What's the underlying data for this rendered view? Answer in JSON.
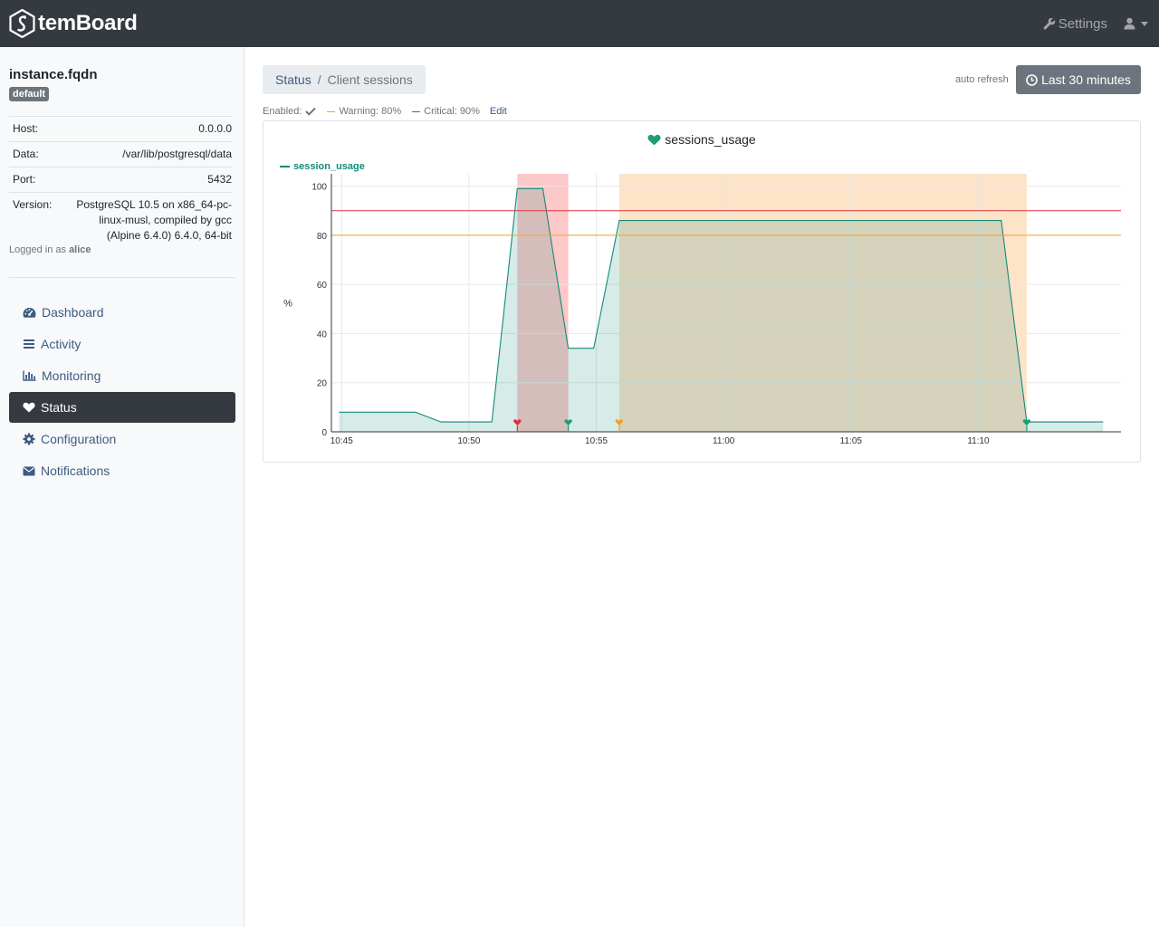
{
  "app": {
    "brand": "temBoard"
  },
  "navbar": {
    "settings_label": "Settings",
    "settings_icon": "wrench-icon",
    "user_icon": "user-icon"
  },
  "sidebar": {
    "instance_name": "instance.fqdn",
    "environment_badge": "default",
    "info": [
      {
        "label": "Host:",
        "value": "0.0.0.0"
      },
      {
        "label": "Data:",
        "value": "/var/lib/postgresql/data"
      },
      {
        "label": "Port:",
        "value": "5432"
      },
      {
        "label": "Version:",
        "value": "PostgreSQL 10.5 on x86_64-pc-linux-musl, compiled by gcc (Alpine 6.4.0) 6.4.0, 64-bit"
      }
    ],
    "logged_in_prefix": "Logged in as",
    "username": "alice",
    "menu": [
      {
        "label": "Dashboard",
        "icon": "tachometer-icon",
        "active": false
      },
      {
        "label": "Activity",
        "icon": "list-icon",
        "active": false
      },
      {
        "label": "Monitoring",
        "icon": "bar-chart-icon",
        "active": false
      },
      {
        "label": "Status",
        "icon": "heart-icon",
        "active": true
      },
      {
        "label": "Configuration",
        "icon": "gear-icon",
        "active": false
      },
      {
        "label": "Notifications",
        "icon": "envelope-icon",
        "active": false
      }
    ]
  },
  "breadcrumb": {
    "parent": "Status",
    "separator": "/",
    "current": "Client sessions"
  },
  "toolbar": {
    "auto_refresh": "auto refresh",
    "range_label": "Last 30 minutes",
    "range_icon": "clock-icon"
  },
  "check": {
    "enabled_label": "Enabled:",
    "warning_label": "Warning: 80%",
    "critical_label": "Critical: 90%",
    "edit_label": "Edit"
  },
  "colors": {
    "warning": "#f0a22f",
    "critical": "#d9343c",
    "series": "#138a7a",
    "ok": "#1f9e6e",
    "warning_band": "#fde3c8",
    "critical_band": "#fcc8c8"
  },
  "chart_data": {
    "type": "area",
    "title": "sessions_usage",
    "ylabel": "%",
    "ylim": [
      0,
      105
    ],
    "yticks": [
      0,
      20,
      40,
      60,
      80,
      100
    ],
    "xticks": [
      "10:45",
      "10:50",
      "10:55",
      "11:00",
      "11:05",
      "11:10"
    ],
    "xrange": [
      "10:44.6",
      "11:15.6"
    ],
    "thresholds": {
      "warning": 80,
      "critical": 90
    },
    "series": [
      {
        "name": "session_usage",
        "x": [
          "10:44.9",
          "10:47.9",
          "10:48.9",
          "10:50.9",
          "10:51.9",
          "10:52.9",
          "10:53.9",
          "10:54.9",
          "10:55.9",
          "11:10.9",
          "11:11.9",
          "11:14.9"
        ],
        "y": [
          8,
          8,
          4,
          4,
          99,
          99,
          34,
          34,
          86,
          86,
          4,
          4
        ]
      }
    ],
    "bands": [
      {
        "state": "critical",
        "from": "10:51.9",
        "to": "10:53.9"
      },
      {
        "state": "warning",
        "from": "10:55.9",
        "to": "11:11.9"
      }
    ],
    "state_markers": [
      {
        "x": "10:51.9",
        "state": "critical"
      },
      {
        "x": "10:53.9",
        "state": "ok"
      },
      {
        "x": "10:55.9",
        "state": "warning"
      },
      {
        "x": "11:11.9",
        "state": "ok"
      }
    ]
  }
}
